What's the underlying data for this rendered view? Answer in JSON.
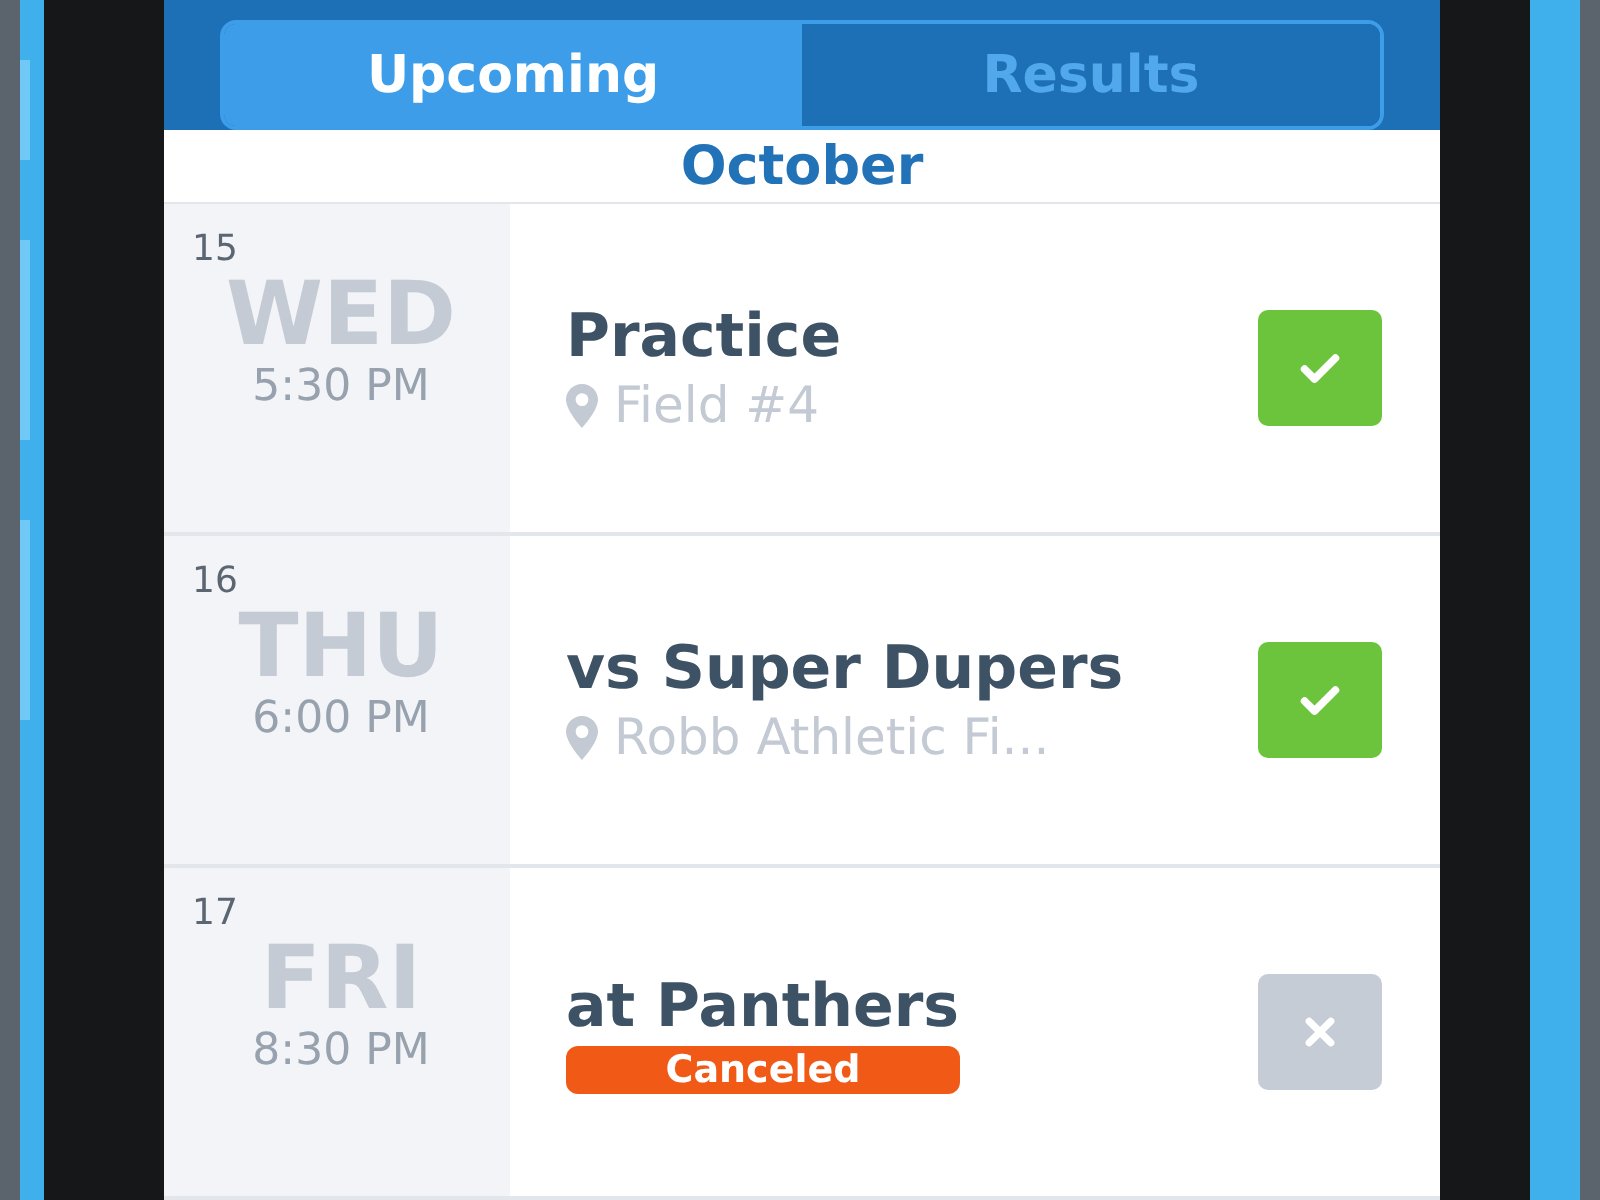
{
  "tabs": [
    {
      "label": "Upcoming",
      "selected": true
    },
    {
      "label": "Results",
      "selected": false
    }
  ],
  "month": "October",
  "events": [
    {
      "day": "15",
      "weekday": "WED",
      "time": "5:30 PM",
      "title": "Practice",
      "location": "Field #4",
      "going": true
    },
    {
      "day": "16",
      "weekday": "THU",
      "time": "6:00 PM",
      "title": "vs Super Dupers",
      "location": "Robb Athletic Fi...",
      "going": true
    },
    {
      "day": "17",
      "weekday": "FRI",
      "time": "8:30 PM",
      "title": "at Panthers",
      "badge": "Canceled",
      "going": false
    }
  ]
}
